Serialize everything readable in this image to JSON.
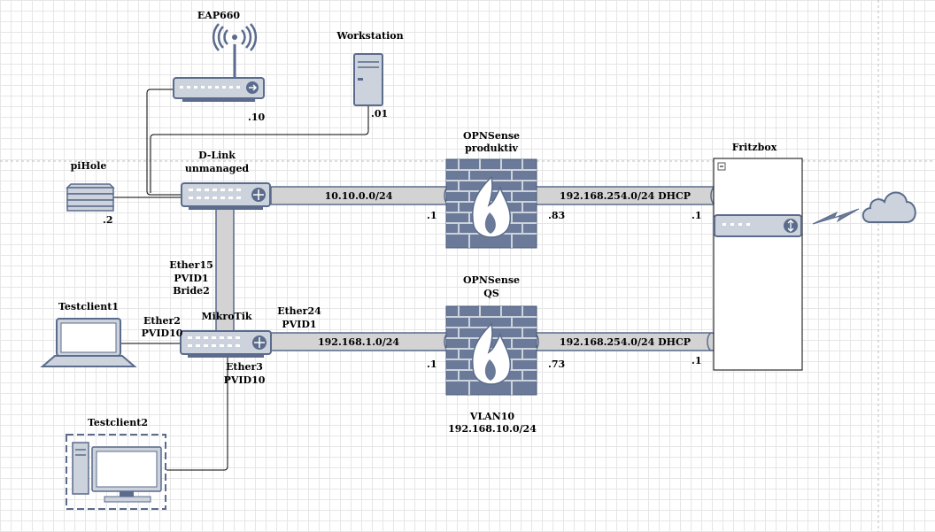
{
  "devices": {
    "eap": "EAP660",
    "workstation": "Workstation",
    "dlink_line1": "D-Link",
    "dlink_line2": "unmanaged",
    "pihole": "piHole",
    "opn1_line1": "OPNSense",
    "opn1_line2": "produktiv",
    "opn2_line1": "OPNSense",
    "opn2_line2": "QS",
    "fritzbox": "Fritzbox",
    "mikrotik": "MikroTik",
    "testclient1": "Testclient1",
    "testclient2": "Testclient2"
  },
  "addresses": {
    "eap": ".10",
    "workstation": ".01",
    "pihole": ".2",
    "opn1_lan": ".1",
    "opn1_wan": ".83",
    "fritz_top": ".1",
    "opn2_lan": ".1",
    "opn2_wan": ".73",
    "fritz_bottom": ".1"
  },
  "links": {
    "net_top_lan": "10.10.0.0/24",
    "net_top_wan": "192.168.254.0/24 DHCP",
    "net_bottom_lan": "192.168.1.0/24",
    "net_bottom_wan": "192.168.254.0/24 DHCP"
  },
  "ports": {
    "ether15_1": "Ether15",
    "ether15_2": "PVID1",
    "ether15_3": "Bride2",
    "ether2_1": "Ether2",
    "ether2_2": "PVID10",
    "ether24_1": "Ether24",
    "ether24_2": "PVID1",
    "ether3_1": "Ether3",
    "ether3_2": "PVID10"
  },
  "vlan": {
    "name": "VLAN10",
    "subnet": "192.168.10.0/24"
  },
  "colors": {
    "device_fill": "#cdd3dd",
    "device_stroke": "#5a6b8c",
    "pipe_fill": "#d3d3d3",
    "pipe_stroke": "#5a6b8c",
    "firewall_fill": "#6b7a99",
    "dashed_line": "#bfbfbf"
  }
}
